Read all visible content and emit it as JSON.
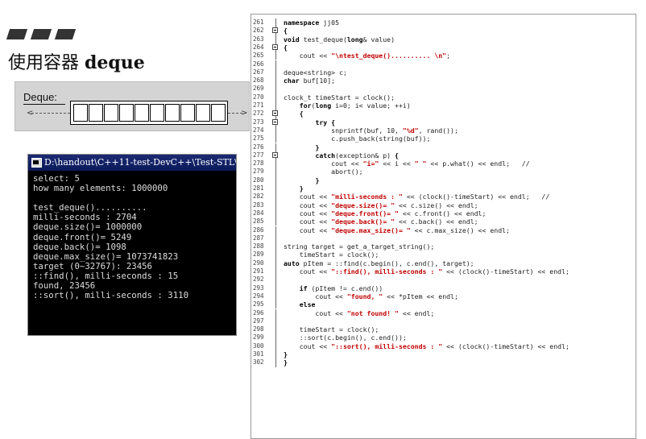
{
  "slide": {
    "title_cn": "使用容器 ",
    "title_en": "deque"
  },
  "deque_diagram": {
    "label": "Deque:",
    "cell_count": 10
  },
  "console": {
    "title": "D:\\handout\\C++11-test-DevC++\\Test-STL\\tes",
    "lines": [
      "select: 5",
      "how many elements: 1000000",
      "",
      "test_deque()..........",
      "milli-seconds : 2704",
      "deque.size()= 1000000",
      "deque.front()= 5249",
      "deque.back()= 1098",
      "deque.max_size()= 1073741823",
      "target (0~32767): 23456",
      "::find(), milli-seconds : 15",
      "found, 23456",
      "::sort(), milli-seconds : 3110"
    ]
  },
  "code": {
    "lines": [
      {
        "n": "261",
        "html": "<span class=kw>namespace</span> jj05"
      },
      {
        "n": "262",
        "html": "<span class=kw>{</span>"
      },
      {
        "n": "263",
        "html": "<span class=kw>void</span> test_deque(<span class=kw>long</span>& value)"
      },
      {
        "n": "264",
        "html": "<span class=kw>{</span>"
      },
      {
        "n": "265",
        "html": "    cout << <span class=str>\"\\ntest_deque().......... \\n\"</span>;"
      },
      {
        "n": "266",
        "html": ""
      },
      {
        "n": "267",
        "html": "deque&lt;string&gt; c;"
      },
      {
        "n": "268",
        "html": "<span class=kw>char</span> buf[10];"
      },
      {
        "n": "269",
        "html": ""
      },
      {
        "n": "270",
        "html": "clock_t timeStart = clock();"
      },
      {
        "n": "271",
        "html": "    <span class=kw>for</span>(<span class=kw>long</span> i=0; i&lt; value; ++i)"
      },
      {
        "n": "272",
        "html": "    <span class=kw>{</span>"
      },
      {
        "n": "273",
        "html": "        <span class=kw>try</span> <span class=kw>{</span>"
      },
      {
        "n": "274",
        "html": "            snprintf(buf, 10, <span class=str>\"%d\"</span>, rand());"
      },
      {
        "n": "275",
        "html": "            c.push_back(string(buf));"
      },
      {
        "n": "276",
        "html": "        <span class=kw>}</span>"
      },
      {
        "n": "277",
        "html": "        <span class=kw>catch</span>(exception& p) <span class=kw>{</span>"
      },
      {
        "n": "278",
        "html": "            cout << <span class=str>\"i=\"</span> << i << <span class=str>\" \"</span> << p.what() << endl;   //"
      },
      {
        "n": "279",
        "html": "            abort();"
      },
      {
        "n": "280",
        "html": "        <span class=kw>}</span>"
      },
      {
        "n": "281",
        "html": "    <span class=kw>}</span>"
      },
      {
        "n": "282",
        "html": "    cout << <span class=str>\"milli-seconds : \"</span> << (clock()-timeStart) << endl;   //"
      },
      {
        "n": "283",
        "html": "    cout << <span class=str>\"deque.size()= \"</span> << c.size() << endl;"
      },
      {
        "n": "284",
        "html": "    cout << <span class=str>\"deque.front()= \"</span> << c.front() << endl;"
      },
      {
        "n": "285",
        "html": "    cout << <span class=str>\"deque.back()= \"</span> << c.back() << endl;"
      },
      {
        "n": "286",
        "html": "    cout << <span class=str>\"deque.max_size()= \"</span> << c.max_size() << endl;"
      },
      {
        "n": "287",
        "html": ""
      },
      {
        "n": "288",
        "html": "string target = get_a_target_string();"
      },
      {
        "n": "289",
        "html": "    timeStart = clock();"
      },
      {
        "n": "290",
        "html": "<span class=kw>auto</span> pItem = ::find(c.begin(), c.end(), target);"
      },
      {
        "n": "291",
        "html": "    cout << <span class=str>\"::find(), milli-seconds : \"</span> << (clock()-timeStart) << endl;"
      },
      {
        "n": "292",
        "html": ""
      },
      {
        "n": "293",
        "html": "    <span class=kw>if</span> (pItem != c.end())"
      },
      {
        "n": "294",
        "html": "        cout << <span class=str>\"found, \"</span> << *pItem << endl;"
      },
      {
        "n": "295",
        "html": "    <span class=kw>else</span>"
      },
      {
        "n": "296",
        "html": "        cout << <span class=str>\"not found! \"</span> << endl;"
      },
      {
        "n": "297",
        "html": ""
      },
      {
        "n": "298",
        "html": "    timeStart = clock();"
      },
      {
        "n": "299",
        "html": "    ::sort(c.begin(), c.end());"
      },
      {
        "n": "300",
        "html": "    cout << <span class=str>\"::sort(), milli-seconds : \"</span> << (clock()-timeStart) << endl;"
      },
      {
        "n": "301",
        "html": "<span class=kw>}</span>"
      },
      {
        "n": "302",
        "html": "<span class=kw>}</span>"
      }
    ],
    "folds": [
      "262",
      "264",
      "272",
      "273",
      "277"
    ]
  }
}
